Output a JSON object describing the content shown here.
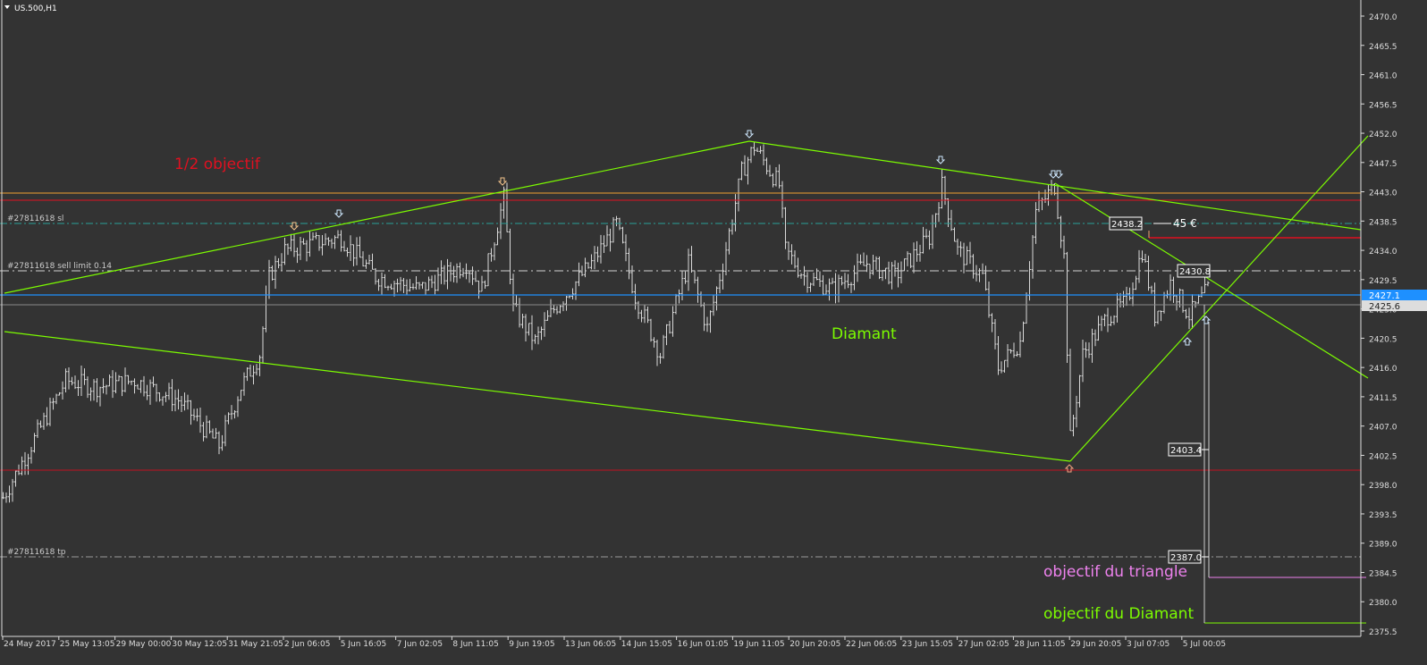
{
  "header": {
    "symbol": "US.500,H1"
  },
  "chart_data": {
    "type": "bar",
    "ylim": [
      2375.5,
      2470.0
    ],
    "price_ticks": [
      "2470.0",
      "2465.5",
      "2461.0",
      "2456.5",
      "2452.0",
      "2447.5",
      "2443.0",
      "2438.5",
      "2434.0",
      "2429.5",
      "2425.0",
      "2420.5",
      "2416.0",
      "2411.5",
      "2407.0",
      "2402.5",
      "2398.0",
      "2393.5",
      "2389.0",
      "2384.5",
      "2380.0",
      "2375.5"
    ],
    "time_labels": [
      "24 May 2017",
      "25 May 13:05",
      "29 May 00:00",
      "30 May 12:05",
      "31 May 21:05",
      "2 Jun 06:05",
      "5 Jun 16:05",
      "7 Jun 02:05",
      "8 Jun 11:05",
      "9 Jun 19:05",
      "13 Jun 06:05",
      "14 Jun 15:05",
      "16 Jun 01:05",
      "19 Jun 11:05",
      "20 Jun 20:05",
      "22 Jun 06:05",
      "23 Jun 15:05",
      "27 Jun 02:05",
      "28 Jun 11:05",
      "29 Jun 20:05",
      "3 Jul 07:05",
      "5 Jul 00:05"
    ],
    "price_path": [
      [
        1,
        2396
      ],
      [
        11,
        2405
      ],
      [
        21,
        2414
      ],
      [
        31,
        2413
      ],
      [
        43,
        2414
      ],
      [
        57,
        2411
      ],
      [
        70,
        2404
      ],
      [
        77,
        2413
      ],
      [
        83,
        2418
      ],
      [
        86,
        2430
      ],
      [
        91,
        2434
      ],
      [
        100,
        2435
      ],
      [
        109,
        2436
      ],
      [
        120,
        2430
      ],
      [
        134,
        2428
      ],
      [
        149,
        2432
      ],
      [
        154,
        2428
      ],
      [
        161,
        2442
      ],
      [
        164,
        2425
      ],
      [
        171,
        2420
      ],
      [
        177,
        2425
      ],
      [
        189,
        2432
      ],
      [
        197,
        2438
      ],
      [
        203,
        2427
      ],
      [
        211,
        2418
      ],
      [
        220,
        2432
      ],
      [
        226,
        2422
      ],
      [
        231,
        2432
      ],
      [
        237,
        2446
      ],
      [
        241,
        2450
      ],
      [
        249,
        2444
      ],
      [
        251,
        2434
      ],
      [
        257,
        2430
      ],
      [
        266,
        2428
      ],
      [
        277,
        2432
      ],
      [
        286,
        2430
      ],
      [
        297,
        2436
      ],
      [
        301,
        2444
      ],
      [
        306,
        2434
      ],
      [
        314,
        2430
      ],
      [
        319,
        2416
      ],
      [
        326,
        2420
      ],
      [
        331,
        2440
      ],
      [
        337,
        2444
      ],
      [
        340,
        2433
      ],
      [
        342,
        2405
      ],
      [
        346,
        2418
      ],
      [
        354,
        2424
      ],
      [
        360,
        2426
      ],
      [
        365,
        2434
      ],
      [
        369,
        2424
      ],
      [
        374,
        2429
      ],
      [
        380,
        2424
      ],
      [
        386,
        2428
      ],
      [
        387,
        2420
      ]
    ],
    "current_bid": "2427.1",
    "current_ask": "2425.6"
  },
  "levels": {
    "sl_label": "#27811618 sl",
    "sell_limit_label": "#27811618 sell limit 0.14",
    "tp_label": "#27811618 tp",
    "sl_price": "2438.2",
    "sell_limit_price": "2430.8",
    "low_price": "2403.4",
    "tp_price": "2387.0",
    "profit_text": "45 €"
  },
  "annotations": {
    "half_objective": "1/2 objectif",
    "diamond": "Diamant",
    "triangle_target": "objectif du triangle",
    "diamond_target": "objectif du Diamant"
  },
  "colors": {
    "background": "#333333",
    "bars": "#d8d8d8",
    "trend": "#7cfc00",
    "red": "#e01020",
    "orange": "#f0a030",
    "blue": "#1e90ff",
    "pink": "#ee82ee",
    "teal": "#2aa198"
  }
}
